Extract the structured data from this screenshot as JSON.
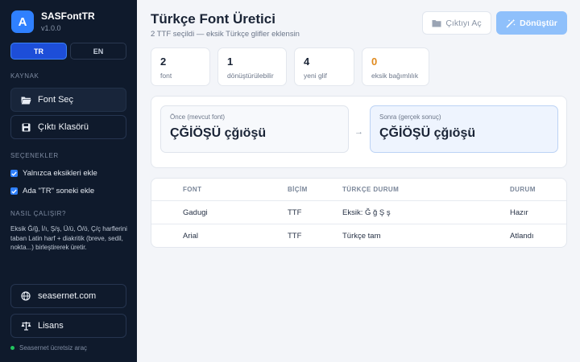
{
  "app": {
    "name": "SASFontTR",
    "version": "v1.0.0",
    "logo_letter": "A",
    "accent": "#2f80ff"
  },
  "language": {
    "tr": "TR",
    "en": "EN",
    "active": "TR"
  },
  "sidebar": {
    "source_label": "KAYNAK",
    "select_font": "Font Seç",
    "output_folder": "Çıktı Klasörü",
    "options_label": "SEÇENEKLER",
    "options": [
      {
        "label": "Yalnızca eksikleri ekle",
        "checked": true
      },
      {
        "label": "Ada \"TR\" soneki ekle",
        "checked": true
      }
    ],
    "how_label": "NASIL ÇALIŞIR?",
    "how_text": "Eksik Ğ/ğ, İ/ı, Ş/ş, Ü/ü, Ö/ö, Ç/ç harflerini taban Latin harf + diakritik (breve, sedil, nokta...) birleştirerek üretir.",
    "website": "seasernet.com",
    "license": "Lisans",
    "status": "Seasernet ücretsiz araç"
  },
  "header": {
    "title": "Türkçe Font Üretici",
    "subtitle": "2 TTF seçildi — eksik Türkçe glifler eklensin",
    "open_output": "Çıktıyı Aç",
    "convert": "Dönüştür"
  },
  "stats": [
    {
      "value": "2",
      "label": "font"
    },
    {
      "value": "1",
      "label": "dönüştürülebilir"
    },
    {
      "value": "4",
      "label": "yeni glif"
    },
    {
      "value": "0",
      "label": "eksik bağımlılık",
      "color": "#e08a1e"
    }
  ],
  "preview": {
    "before_label": "Önce (mevcut font)",
    "before_text": "ÇĞİÖŞÜ çğıöşü",
    "after_label": "Sonra (gerçek sonuç)",
    "after_text": "ÇĞİÖŞÜ çğıöşü"
  },
  "table": {
    "headers": [
      "FONT",
      "BİÇİM",
      "TÜRKÇE DURUM",
      "DURUM"
    ],
    "rows": [
      [
        "Gadugi",
        "TTF",
        "Eksik: Ğ ğ Ş ş",
        "Hazır"
      ],
      [
        "Arial",
        "TTF",
        "Türkçe tam",
        "Atlandı"
      ]
    ]
  }
}
